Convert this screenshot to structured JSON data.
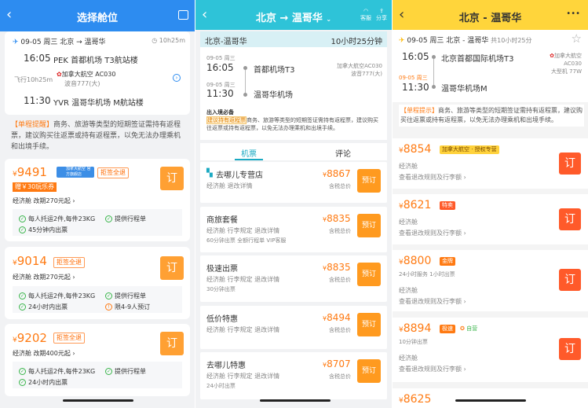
{
  "p1": {
    "title": "选择舱位",
    "flight": {
      "head": "09-05 周三  北京 → 温哥华",
      "duration": "10h25m",
      "dep_time": "16:05",
      "dep_ap": "PEK 首都机场 T3航站楼",
      "fly": "飞行10h25m",
      "airline": "加拿大航空 AC030",
      "plane": "波音777(大)",
      "arr_time": "11:30",
      "arr_ap": "YVR 温哥华机场 M航站楼"
    },
    "tip_label": "【单程提醒】",
    "tip": "商务、旅游等类型的短期签证需持有返程票，建议购买往返票或持有返程票，以免无法办理乘机和出境手续。",
    "cards": [
      {
        "price": "9491",
        "tag": "加拿大航空 官方旗舰店",
        "badge": "拒签全退",
        "coupon": "赠￥30玩乐券",
        "cls": "经济舱",
        "change": "改期270元起",
        "feats": [
          "每人托运2件,每件23KG",
          "提供行程单",
          "45分钟内出票"
        ]
      },
      {
        "price": "9014",
        "badge": "拒签全退",
        "cls": "经济舱",
        "change": "改期270元起",
        "feats": [
          "每人托运2件,每件23KG",
          "提供行程单",
          "24小时内出票",
          "限4-9人预订"
        ]
      },
      {
        "price": "9202",
        "badge": "拒签全退",
        "cls": "经济舱",
        "change": "改期400元起",
        "feats": [
          "每人托运2件,每件23KG",
          "提供行程单",
          "24小时内出票"
        ]
      }
    ],
    "btn": "订"
  },
  "p2": {
    "title": "北京 → 温哥华",
    "service": "客服",
    "share": "分享",
    "route": "北京-温哥华",
    "duration": "10小时25分钟",
    "dep_date": "09-05 周三",
    "dep_time": "16:05",
    "dep_ap": "首都机场T3",
    "airline": "加拿大航空AC030",
    "plane": "波音777(大)",
    "arr_date": "09-05 周三",
    "arr_time": "11:30",
    "arr_ap": "温哥华机场",
    "must_title": "出入境必备",
    "must_link": "建议持有返程票",
    "must_text": "商务、旅游等类型的短期签证需持有返程票，建议购买往返票或持有返程票，以免无法办理乘机和出境手续。",
    "tab1": "机票",
    "tab2": "评论",
    "items": [
      {
        "name": "去哪儿专营店",
        "sub": "经济舱  退改详情",
        "note": "",
        "price": "8867",
        "tax": "含税总价"
      },
      {
        "name": "商旅套餐",
        "sub": "经济舱  行李规定  退改详情",
        "note": "60分钟出票  全额行程单  VIP客服",
        "price": "8835",
        "tax": "含税总价"
      },
      {
        "name": "极速出票",
        "sub": "经济舱  行李规定  退改详情",
        "note": "30分钟出票",
        "price": "8835",
        "tax": "含税总价"
      },
      {
        "name": "低价特惠",
        "sub": "经济舱  行李规定  退改详情",
        "note": "",
        "price": "8494",
        "tax": "含税总价"
      },
      {
        "name": "去哪儿特惠",
        "sub": "经济舱  行李规定  退改详情",
        "note": "24小时出票",
        "price": "8707",
        "tax": "含税总价"
      }
    ],
    "btn": "预订"
  },
  "p3": {
    "title": "北京 - 温哥华",
    "more": "•••",
    "head": "09-05 周三 北京 - 温哥华",
    "duration": "共10小时25分",
    "dep_time": "16:05",
    "dep_ap": "北京首都国际机场T3",
    "airline": "加拿大航空",
    "flight_no": "AC030",
    "plane": "大型机 77W",
    "arr_date": "09-05 周三",
    "arr_time": "11:30",
    "arr_ap": "温哥华机场M",
    "tip_label": "【单程提示】",
    "tip": "商务、旅游等类型的短期签证需持有返程票，建议购买往返票或持有返程票，以免无法办理乘机和出境手续。",
    "items": [
      {
        "price": "8854",
        "tag": "加拿大航空 · 授权专营",
        "note": "",
        "cls": "经济舱",
        "rule": "查看退改规则及行李额"
      },
      {
        "price": "8621",
        "tag": "特卖",
        "note": "",
        "cls": "经济舱",
        "rule": "查看退改规则及行李额"
      },
      {
        "price": "8800",
        "tag": "金牌",
        "note": "24小时服务  1小时出票",
        "cls": "经济舱",
        "rule": "查看退改规则及行李额"
      },
      {
        "price": "8894",
        "tag": "极速",
        "tag2": "自营",
        "note": "10分钟出票",
        "cls": "经济舱",
        "rule": "查看退改规则及行李额"
      },
      {
        "price": "8625"
      }
    ],
    "btn": "订"
  }
}
